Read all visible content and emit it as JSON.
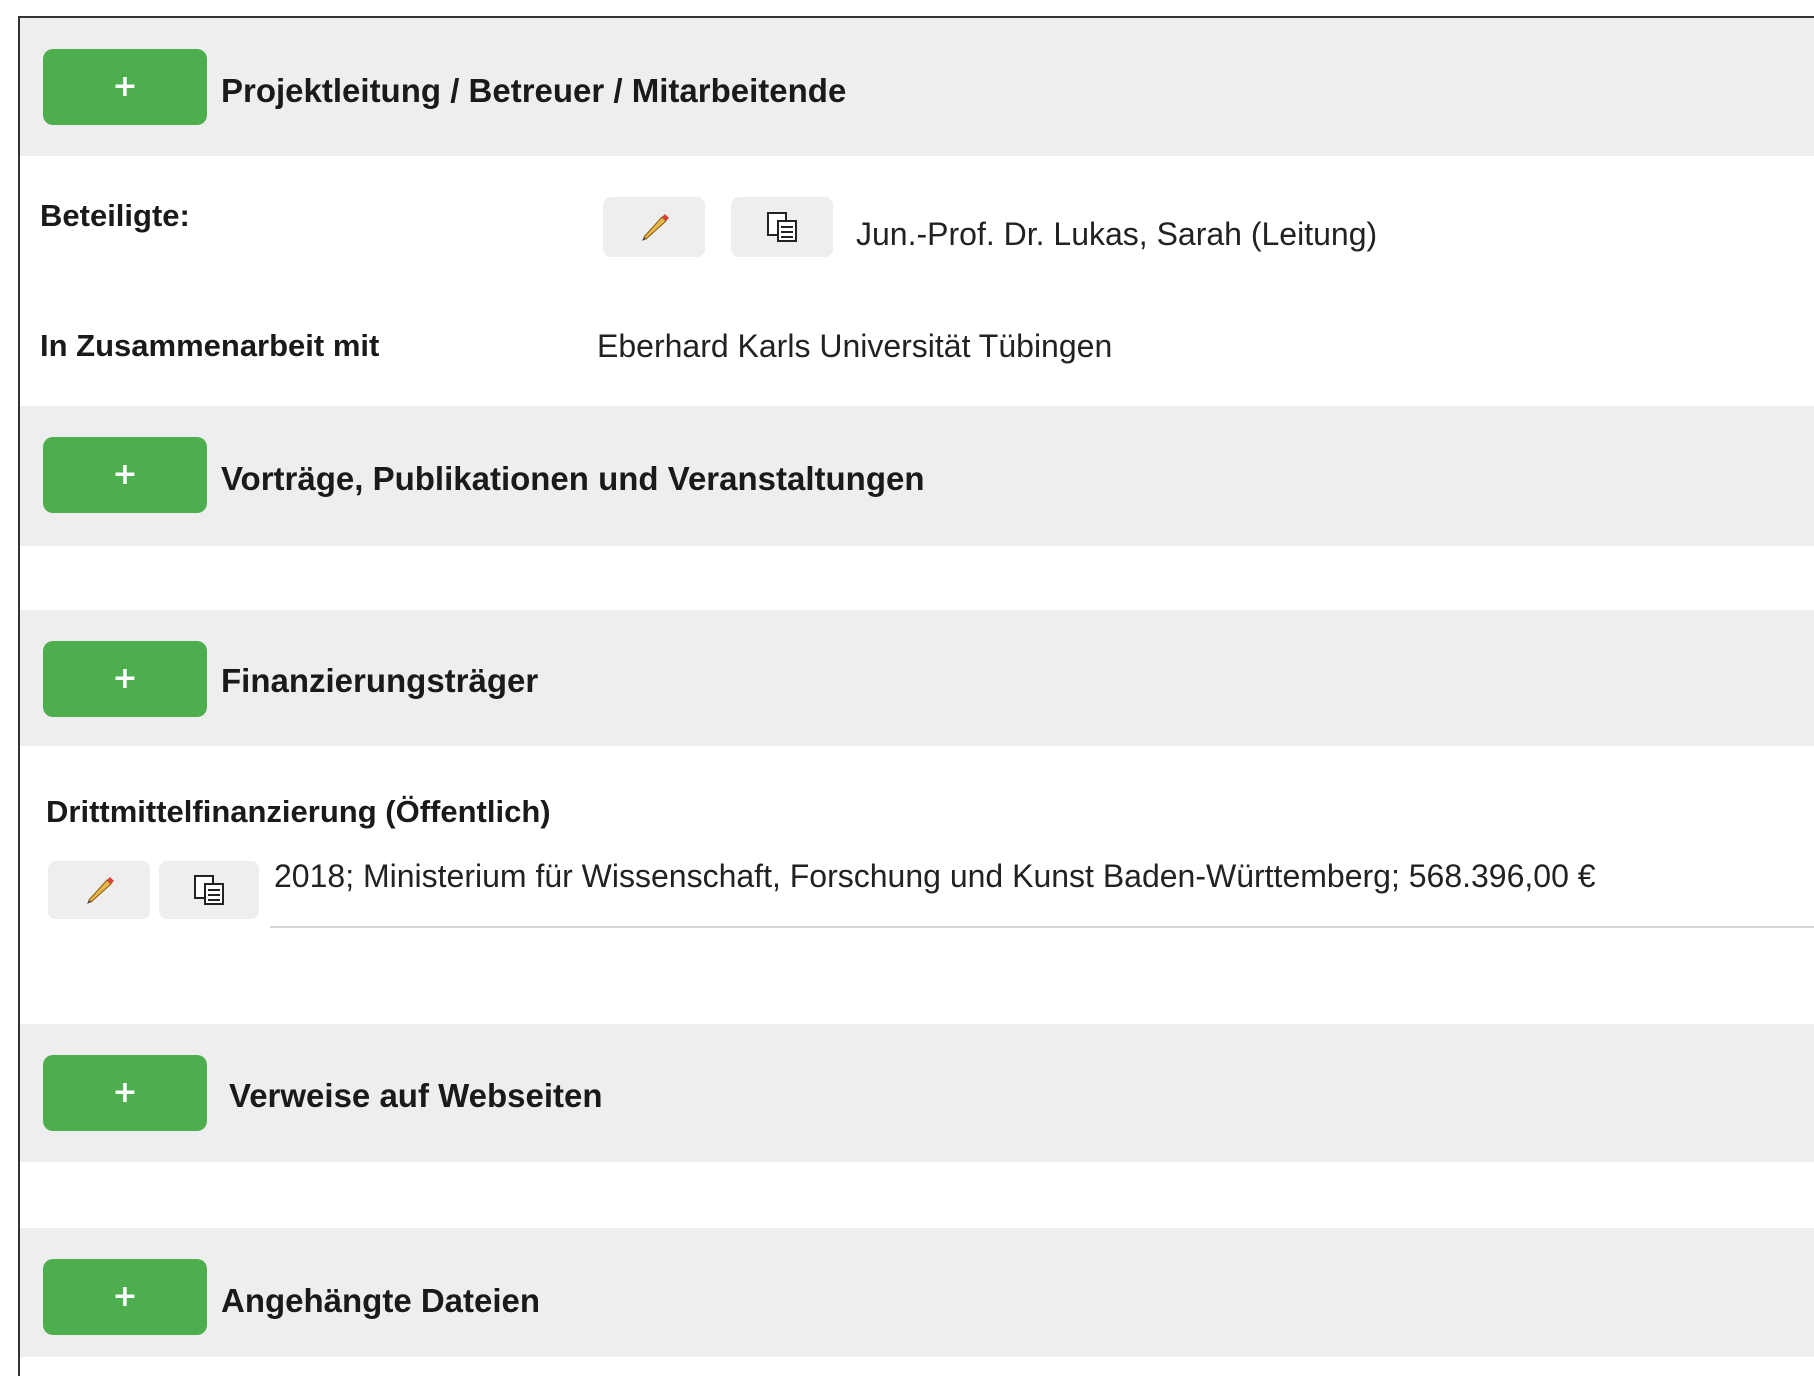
{
  "sections": {
    "projektleitung": {
      "title": "Projektleitung / Betreuer / Mitarbeitende",
      "add_label": "+"
    },
    "vortraege": {
      "title": "Vorträge, Publikationen und Veranstaltungen",
      "add_label": "+"
    },
    "finanzierung": {
      "title": "Finanzierungsträger",
      "add_label": "+"
    },
    "webseiten": {
      "title": "Verweise auf Webseiten",
      "add_label": "+"
    },
    "dateien": {
      "title": "Angehängte Dateien",
      "add_label": "+"
    }
  },
  "beteiligte": {
    "label": "Beteiligte:",
    "person": "Jun.-Prof. Dr. Lukas, Sarah (Leitung)"
  },
  "zusammenarbeit": {
    "label": "In Zusammenarbeit mit",
    "value": "Eberhard Karls Universität Tübingen"
  },
  "drittmittel": {
    "heading": "Drittmittelfinanzierung (Öffentlich)",
    "entry": "2018; Ministerium für Wissenschaft, Forschung und Kunst Baden-Württemberg; 568.396,00 €"
  },
  "icons": {
    "edit": "pencil-icon",
    "copy": "copy-icon"
  }
}
